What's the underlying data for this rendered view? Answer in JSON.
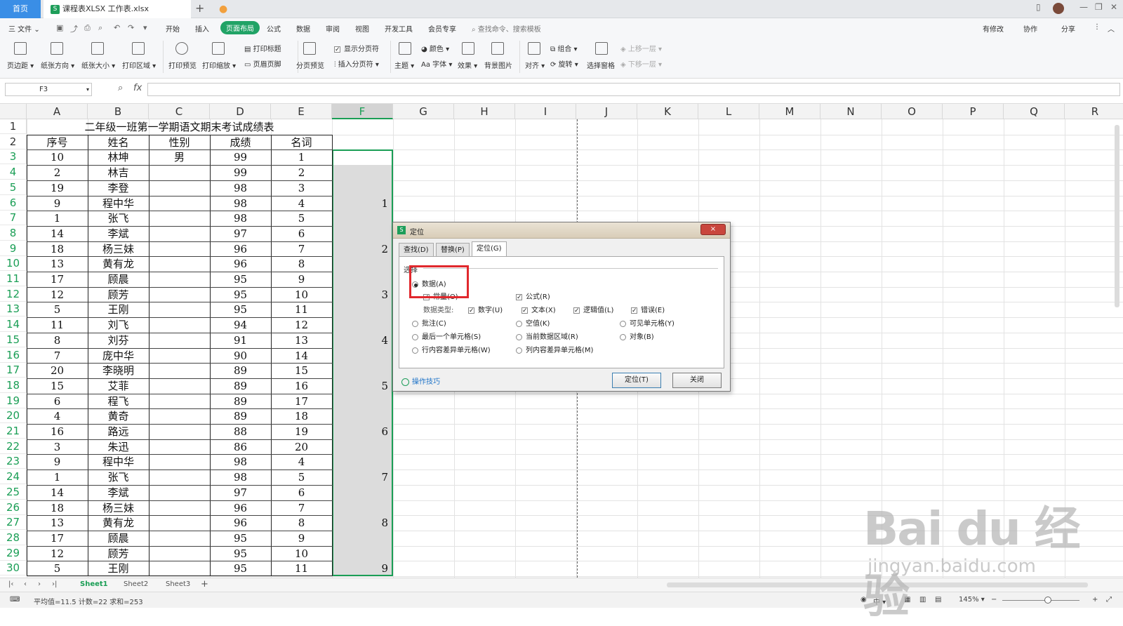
{
  "titlebar": {
    "home_tab": "首页",
    "file_tab": "课程表XLSX 工作表.xlsx",
    "xlsx_icon": "S",
    "plus": "+"
  },
  "menubar": {
    "file_menu": "三 文件 ⌄",
    "items": [
      "开始",
      "插入",
      "页面布局",
      "公式",
      "数据",
      "审阅",
      "视图",
      "开发工具",
      "会员专享"
    ],
    "active": "页面布局",
    "search": "查找命令、搜索模板",
    "right": [
      "有修改",
      "协作",
      "分享"
    ]
  },
  "ribbon": {
    "groups": [
      "页边距 ▾",
      "纸张方向 ▾",
      "纸张大小 ▾",
      "打印区域 ▾",
      "打印预览",
      "打印缩放 ▾",
      "打印标题",
      "页眉页脚",
      "分页预览",
      "显示分页符",
      "插入分页符 ▾",
      "主题 ▾",
      "颜色 ▾",
      "Aa 字体 ▾",
      "效果 ▾",
      "背景图片",
      "对齐 ▾",
      "组合 ▾",
      "旋转 ▾",
      "选择窗格",
      "上移一层 ▾",
      "下移一层 ▾"
    ]
  },
  "formulabar": {
    "namebox": "F3",
    "fx": "fx"
  },
  "sheet": {
    "columns": [
      "A",
      "B",
      "C",
      "D",
      "E",
      "F",
      "G",
      "H",
      "I",
      "J",
      "K",
      "L",
      "M",
      "N",
      "O",
      "P",
      "Q",
      "R"
    ],
    "selected_column": "F",
    "rows": [
      "1",
      "2",
      "3",
      "4",
      "5",
      "6",
      "7",
      "8",
      "9",
      "10",
      "11",
      "12",
      "13",
      "14",
      "15",
      "16",
      "17",
      "18",
      "19",
      "20",
      "21",
      "22",
      "23",
      "24",
      "25",
      "26",
      "27",
      "28",
      "29",
      "30"
    ],
    "title": "二年级一班第一学期语文期末考试成绩表",
    "headers": [
      "序号",
      "姓名",
      "性别",
      "成绩",
      "名词"
    ],
    "data": [
      [
        "10",
        "林坤",
        "男",
        "99",
        "1"
      ],
      [
        "2",
        "林吉",
        "",
        "99",
        "2"
      ],
      [
        "19",
        "李登",
        "",
        "98",
        "3"
      ],
      [
        "9",
        "程中华",
        "",
        "98",
        "4"
      ],
      [
        "1",
        "张飞",
        "",
        "98",
        "5"
      ],
      [
        "14",
        "李斌",
        "",
        "97",
        "6"
      ],
      [
        "18",
        "杨三妹",
        "",
        "96",
        "7"
      ],
      [
        "13",
        "黄有龙",
        "",
        "96",
        "8"
      ],
      [
        "17",
        "顾晨",
        "",
        "95",
        "9"
      ],
      [
        "12",
        "顾芳",
        "",
        "95",
        "10"
      ],
      [
        "5",
        "王刚",
        "",
        "95",
        "11"
      ],
      [
        "11",
        "刘飞",
        "",
        "94",
        "12"
      ],
      [
        "8",
        "刘芬",
        "",
        "91",
        "13"
      ],
      [
        "7",
        "庞中华",
        "",
        "90",
        "14"
      ],
      [
        "20",
        "李晓明",
        "",
        "89",
        "15"
      ],
      [
        "15",
        "艾菲",
        "",
        "89",
        "16"
      ],
      [
        "6",
        "程飞",
        "",
        "89",
        "17"
      ],
      [
        "4",
        "黄奇",
        "",
        "89",
        "18"
      ],
      [
        "16",
        "路远",
        "",
        "88",
        "19"
      ],
      [
        "3",
        "朱迅",
        "",
        "86",
        "20"
      ],
      [
        "9",
        "程中华",
        "",
        "98",
        "4"
      ],
      [
        "1",
        "张飞",
        "",
        "98",
        "5"
      ],
      [
        "14",
        "李斌",
        "",
        "97",
        "6"
      ],
      [
        "18",
        "杨三妹",
        "",
        "96",
        "7"
      ],
      [
        "13",
        "黄有龙",
        "",
        "96",
        "8"
      ],
      [
        "17",
        "顾晨",
        "",
        "95",
        "9"
      ],
      [
        "12",
        "顾芳",
        "",
        "95",
        "10"
      ],
      [
        "5",
        "王刚",
        "",
        "95",
        "11"
      ]
    ],
    "f_values": [
      "",
      "",
      "",
      "1",
      "",
      "",
      "2",
      "",
      "",
      "3",
      "",
      "",
      "4",
      "",
      "",
      "5",
      "",
      "",
      "6",
      "",
      "",
      "7",
      "",
      "",
      "8",
      "",
      "",
      "9"
    ]
  },
  "dialog": {
    "title": "定位",
    "close": "×",
    "tabs": [
      "查找(D)",
      "替换(P)",
      "定位(G)"
    ],
    "active_tab": "定位(G)",
    "group": "选择",
    "data_radio": "数据(A)",
    "constant": "常量(O)",
    "formula": "公式(R)",
    "data_type": "数据类型:",
    "types": [
      "数字(U)",
      "文本(X)",
      "逻辑值(L)",
      "错误(E)"
    ],
    "radios": [
      "批注(C)",
      "空值(K)",
      "可见单元格(Y)",
      "最后一个单元格(S)",
      "当前数据区域(R)",
      "对象(B)",
      "行内容差异单元格(W)",
      "列内容差异单元格(M)"
    ],
    "tips": "操作技巧",
    "btn_locate": "定位(T)",
    "btn_close": "关闭"
  },
  "sheettabs": [
    "Sheet1",
    "Sheet2",
    "Sheet3"
  ],
  "status": {
    "summary": "平均值=11.5 计数=22 求和=253",
    "zoom": "145% ▾",
    "ime": "中 ▾"
  },
  "watermark": {
    "big": "Bai du 经验",
    "small": "jingyan.baidu.com"
  }
}
